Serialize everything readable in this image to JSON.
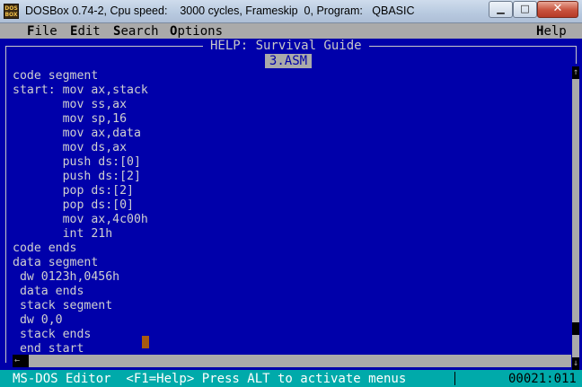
{
  "window": {
    "icon_text": "DOS\nBOX",
    "title": "DOSBox 0.74-2, Cpu speed:    3000 cycles, Frameskip  0, Program:   QBASIC",
    "controls": {
      "minimize": "▁",
      "maximize": "□",
      "close": "✕"
    }
  },
  "menu": {
    "items": [
      "File",
      "Edit",
      "Search",
      "Options"
    ],
    "help": "Help"
  },
  "editor": {
    "window_title": "HELP: Survival Guide",
    "file_tab": "3.ASM",
    "code": "code segment\nstart: mov ax,stack\n       mov ss,ax\n       mov sp,16\n       mov ax,data\n       mov ds,ax\n       push ds:[0]\n       push ds:[2]\n       pop ds:[2]\n       pop ds:[0]\n       mov ax,4c00h\n       int 21h\ncode ends\ndata segment\n dw 0123h,0456h\n data ends\n stack segment\n dw 0,0\n stack ends\n end start"
  },
  "scrollbars": {
    "up": "↑",
    "down": "↓",
    "left": "←"
  },
  "status": {
    "text": "MS-DOS Editor  <F1=Help> Press ALT to activate menus",
    "position": "00021:011"
  }
}
